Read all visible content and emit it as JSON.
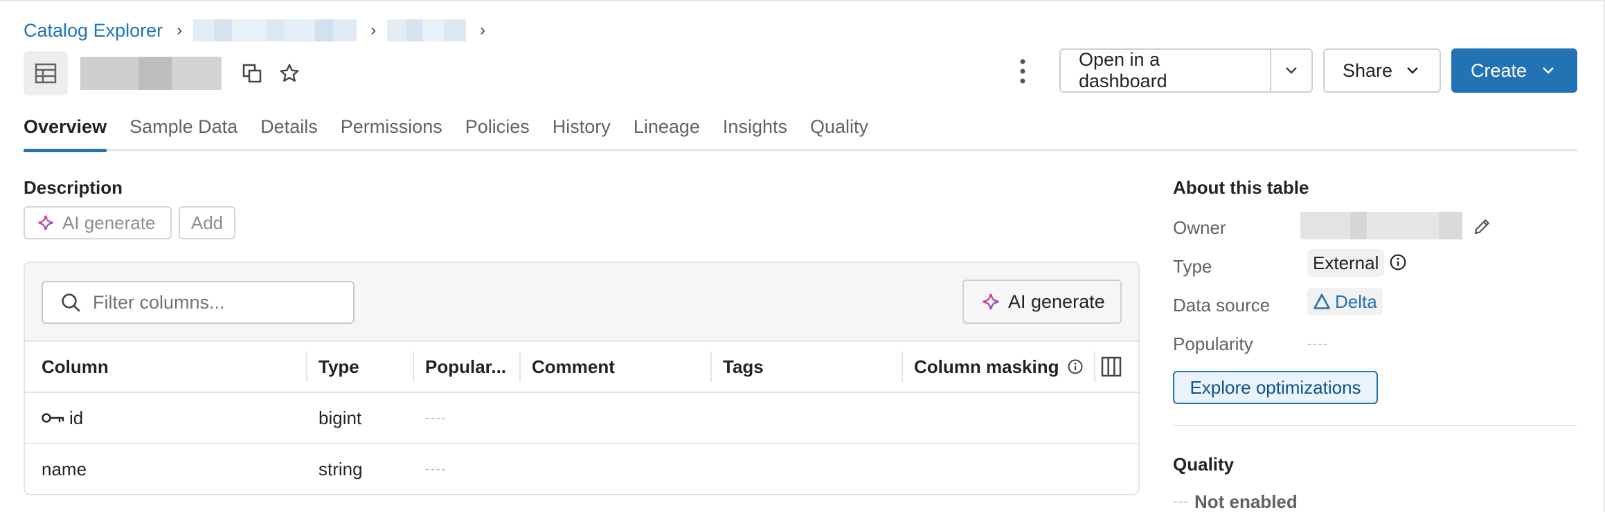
{
  "breadcrumb": {
    "root_label": "Catalog Explorer",
    "separator": "›"
  },
  "toolbar": {
    "open_dashboard_label": "Open in a dashboard",
    "share_label": "Share",
    "create_label": "Create"
  },
  "tabs": [
    {
      "label": "Overview",
      "active": true
    },
    {
      "label": "Sample Data",
      "active": false
    },
    {
      "label": "Details",
      "active": false
    },
    {
      "label": "Permissions",
      "active": false
    },
    {
      "label": "Policies",
      "active": false
    },
    {
      "label": "History",
      "active": false
    },
    {
      "label": "Lineage",
      "active": false
    },
    {
      "label": "Insights",
      "active": false
    },
    {
      "label": "Quality",
      "active": false
    }
  ],
  "description": {
    "heading": "Description",
    "ai_generate_label": "AI generate",
    "add_label": "Add"
  },
  "columns_panel": {
    "filter_placeholder": "Filter columns...",
    "ai_generate_label": "AI generate",
    "headers": {
      "column": "Column",
      "type": "Type",
      "popularity": "Popular...",
      "comment": "Comment",
      "tags": "Tags",
      "masking": "Column masking"
    },
    "rows": [
      {
        "name": "id",
        "type": "bigint",
        "popularity": "----",
        "is_key": true
      },
      {
        "name": "name",
        "type": "string",
        "popularity": "----",
        "is_key": false
      }
    ]
  },
  "about": {
    "heading": "About this table",
    "owner_label": "Owner",
    "type_label": "Type",
    "type_value": "External",
    "source_label": "Data source",
    "source_value": "Delta",
    "popularity_label": "Popularity",
    "popularity_value": "----",
    "explore_label": "Explore optimizations"
  },
  "quality": {
    "heading": "Quality",
    "status_dashes": "---",
    "status": "Not enabled"
  },
  "colors": {
    "accent": "#2272b4",
    "ai_gradient_start": "#e0457b",
    "ai_gradient_end": "#7f56d9"
  }
}
